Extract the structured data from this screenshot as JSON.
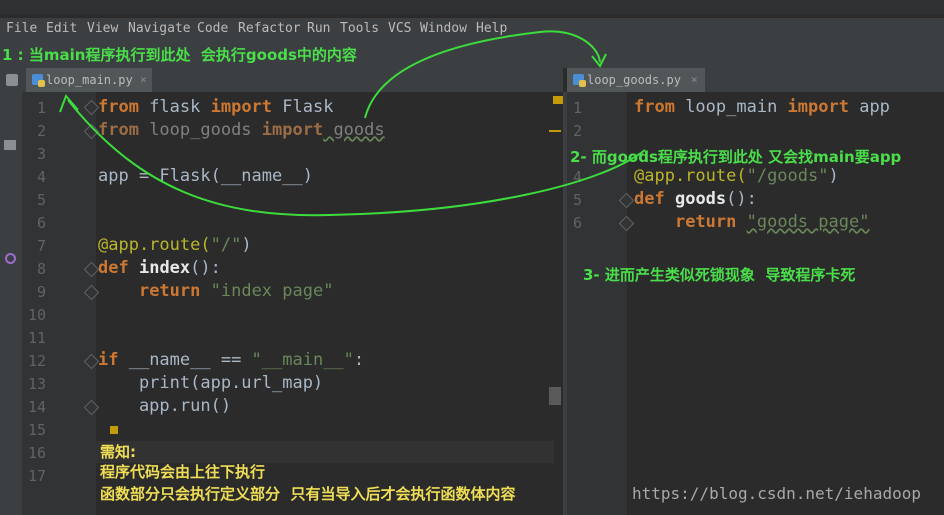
{
  "menu": [
    "File",
    "Edit",
    "View",
    "Navigate",
    "Code",
    "Refactor",
    "Run",
    "Tools",
    "VCS",
    "Window",
    "Help"
  ],
  "tabs": {
    "left": {
      "name": "loop_main.py",
      "close": "×"
    },
    "right": {
      "name": "loop_goods.py",
      "close": "×"
    }
  },
  "left_editor": {
    "line_numbers": [
      "1",
      "2",
      "3",
      "4",
      "5",
      "6",
      "7",
      "8",
      "9",
      "10",
      "11",
      "12",
      "13",
      "14",
      "15",
      "16",
      "17"
    ],
    "lines": {
      "l1": [
        "from",
        " flask ",
        "import",
        " Flask"
      ],
      "l2": [
        "from",
        " loop_goods ",
        "import",
        " goods"
      ],
      "l4": [
        "app = Flask(",
        "__name__",
        ")"
      ],
      "l7": [
        "@app.route(",
        "\"/\"",
        ")"
      ],
      "l8": [
        "def",
        " ",
        "index",
        "():"
      ],
      "l9": [
        "    ",
        "return",
        " ",
        "\"index page\""
      ],
      "l12": [
        "if",
        " __name__ == ",
        "\"__main__\"",
        ":"
      ],
      "l13": "    print(app.url_map)",
      "l14": "    app.run()"
    }
  },
  "right_editor": {
    "line_numbers": [
      "1",
      "2",
      "4",
      "5",
      "6"
    ],
    "lines": {
      "l1": [
        "from",
        " loop_main ",
        "import",
        " app"
      ],
      "l4": [
        "@app.route(",
        "\"/goods\"",
        ")"
      ],
      "l5": [
        "def",
        " ",
        "goods",
        "():"
      ],
      "l6": [
        "    ",
        "return",
        " ",
        "\"goods page\""
      ]
    }
  },
  "annotations": {
    "a1": "1 : 当main程序执行到此处  会执行goods中的内容",
    "a2": "2- 而goods程序执行到此处 又会找main要app",
    "a3": "3- 进而产生类似死锁现象  导致程序卡死",
    "note_title": "需知:",
    "note_1": "程序代码会由上往下执行",
    "note_2": "函数部分只会执行定义部分  只有当导入后才会执行函数体内容"
  },
  "left_strip_text": "loop_main",
  "watermark": "https://blog.csdn.net/iehadoop",
  "colors": {
    "keyword": "#cc7832",
    "string": "#6a8759",
    "annotation": "#4ade4a",
    "background": "#2b2b2b"
  }
}
